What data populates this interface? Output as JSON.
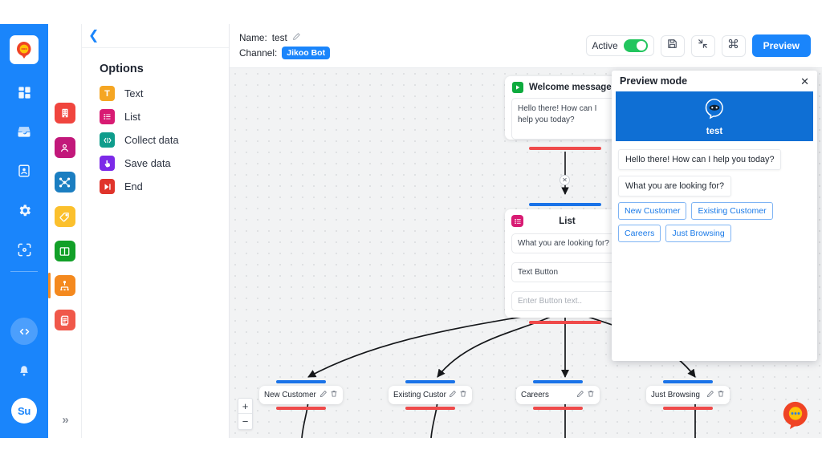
{
  "rail": {
    "logo_icon": "jikoo-logo-icon",
    "items": [
      {
        "name": "dashboard-icon",
        "label": "Dashboard"
      },
      {
        "name": "inbox-icon",
        "label": "Inbox"
      },
      {
        "name": "contacts-icon",
        "label": "Contacts"
      },
      {
        "name": "settings-gear-icon",
        "label": "Settings"
      },
      {
        "name": "scan-eye-icon",
        "label": "Monitor"
      }
    ],
    "bottom": [
      {
        "name": "code-icon",
        "label": "Developer"
      },
      {
        "name": "bell-icon",
        "label": "Notifications"
      }
    ],
    "avatar_initials": "Su"
  },
  "rail2": {
    "items": [
      {
        "name": "building-icon",
        "label": "Company",
        "color": "#f0453e",
        "active": false
      },
      {
        "name": "person-icon",
        "label": "Contacts",
        "color": "#c2187a",
        "active": false
      },
      {
        "name": "network-shuffle-icon",
        "label": "Integrations",
        "color": "#1b7ec1",
        "active": false
      },
      {
        "name": "tag-icon",
        "label": "Tags",
        "color": "#fbc02d",
        "active": false
      },
      {
        "name": "columns-icon",
        "label": "Boards",
        "color": "#12a028",
        "active": false
      },
      {
        "name": "flow-hierarchy-icon",
        "label": "Flows",
        "color": "#f4891e",
        "active": true
      },
      {
        "name": "document-icon",
        "label": "Templates",
        "color": "#f0584a",
        "active": false
      }
    ],
    "expand_label": "»"
  },
  "options": {
    "back_icon": "chevron-left-icon",
    "title": "Options",
    "items": [
      {
        "label": "Text",
        "icon": "text-block-icon",
        "glyph": "T",
        "color": "#f5a623"
      },
      {
        "label": "List",
        "icon": "list-block-icon",
        "glyph": "☰",
        "color": "#d81b73"
      },
      {
        "label": "Collect data",
        "icon": "collect-data-icon",
        "glyph": "‹›",
        "color": "#0f9d8c"
      },
      {
        "label": "Save data",
        "icon": "save-data-icon",
        "glyph": "☝",
        "color": "#7c2ae8"
      },
      {
        "label": "End",
        "icon": "end-block-icon",
        "glyph": "▶|",
        "color": "#e0342b"
      }
    ]
  },
  "header": {
    "name_label": "Name:",
    "name_value": "test",
    "edit_icon": "pencil-icon",
    "channel_label": "Channel:",
    "channel_value": "Jikoo Bot",
    "active_label": "Active",
    "active_on": true,
    "save_icon": "floppy-save-icon",
    "expand_icon": "collapse-arrows-icon",
    "command_icon": "command-key-icon",
    "preview_label": "Preview",
    "accent_color": "#1a85fb",
    "toggle_on_color": "#22c55e"
  },
  "canvas": {
    "welcome_node": {
      "icon": "play-start-icon",
      "title": "Welcome message",
      "message": "Hello there! How can I help you today?",
      "top_bar_color": "#1a73e8",
      "bottom_bar_color": "#ef4a4a"
    },
    "list_node": {
      "icon": "list-block-icon",
      "title": "List",
      "prompt": "What you are looking for?",
      "button_value": "Text Button",
      "button_placeholder": "Enter Button text..",
      "edit_icon": "pencil-icon",
      "top_bar_color": "#1a73e8",
      "bottom_bar_color": "#ef4a4a"
    },
    "leaf_nodes": [
      {
        "label": "New Customer",
        "edit_icon": "pencil-icon",
        "delete_icon": "trash-icon"
      },
      {
        "label": "Existing Custome",
        "edit_icon": "pencil-icon",
        "delete_icon": "trash-icon"
      },
      {
        "label": "Careers",
        "edit_icon": "pencil-icon",
        "delete_icon": "trash-icon"
      },
      {
        "label": "Just Browsing",
        "edit_icon": "pencil-icon",
        "delete_icon": "trash-icon"
      }
    ],
    "edge_delete_label": "✕",
    "zoom_in_label": "+",
    "zoom_out_label": "−",
    "chat_fab_icon": "chat-bubble-icon"
  },
  "preview": {
    "title": "Preview mode",
    "close_icon": "close-icon",
    "bot_avatar_icon": "bot-avatar-icon",
    "bot_name": "test",
    "banner_color": "#0f6fd4",
    "messages": [
      "Hello there! How can I help you today?",
      "What you are looking for?"
    ],
    "choices": [
      "New Customer",
      "Existing Customer",
      "Careers",
      "Just Browsing"
    ]
  }
}
